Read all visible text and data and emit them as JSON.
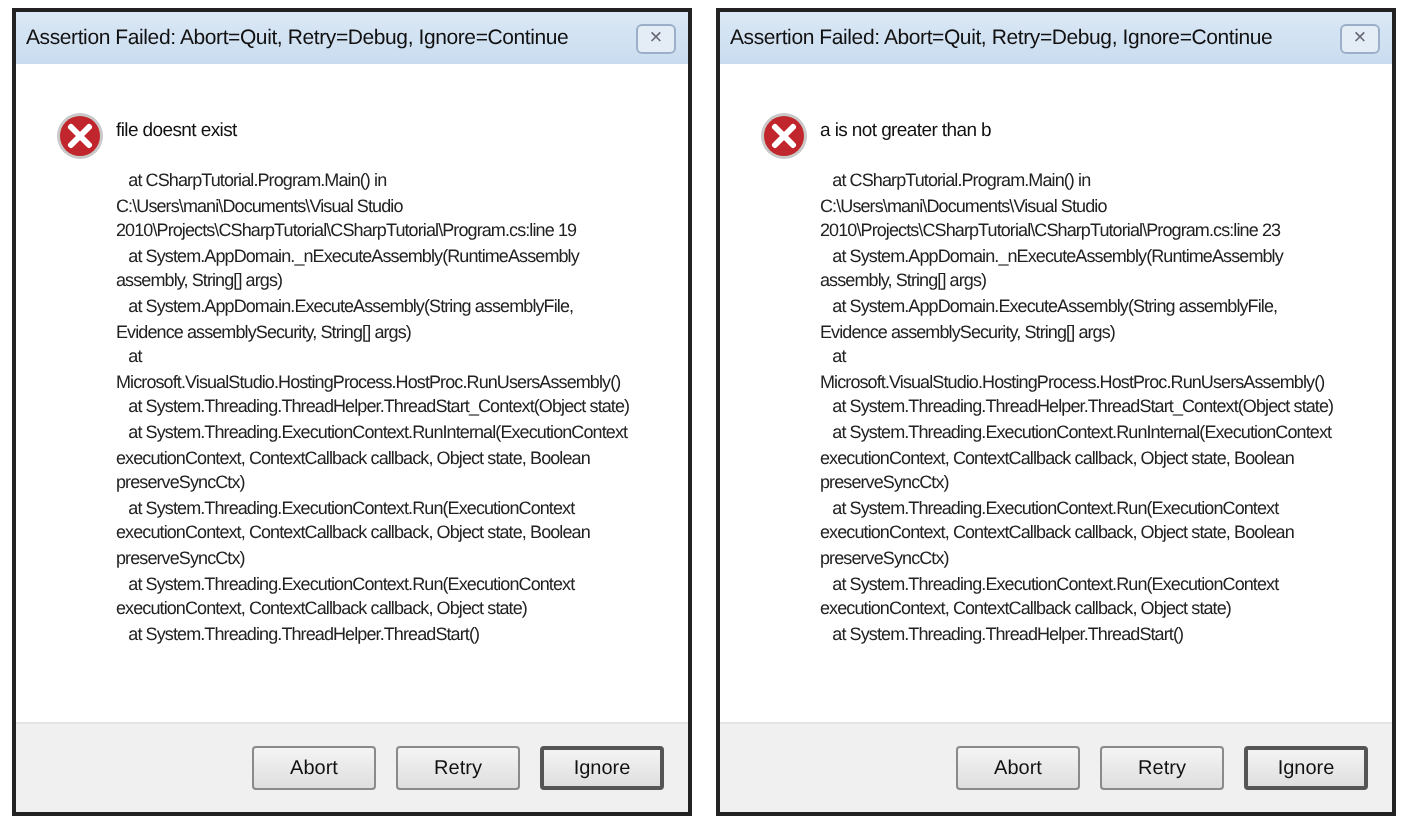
{
  "dialogs": [
    {
      "title": "Assertion Failed: Abort=Quit, Retry=Debug, Ignore=Continue",
      "close": "×",
      "message": "file doesnt exist",
      "stack_lines": [
        "   at CSharpTutorial.Program.Main() in",
        "C:\\Users\\mani\\Documents\\Visual Studio",
        "2010\\Projects\\CSharpTutorial\\CSharpTutorial\\Program.cs:line 19",
        "   at System.AppDomain._nExecuteAssembly(RuntimeAssembly",
        "assembly, String[] args)",
        "   at System.AppDomain.ExecuteAssembly(String assemblyFile,",
        "Evidence assemblySecurity, String[] args)",
        "   at",
        "Microsoft.VisualStudio.HostingProcess.HostProc.RunUsersAssembly()",
        "   at System.Threading.ThreadHelper.ThreadStart_Context(Object state)",
        "   at System.Threading.ExecutionContext.RunInternal(ExecutionContext",
        "executionContext, ContextCallback callback, Object state, Boolean",
        "preserveSyncCtx)",
        "   at System.Threading.ExecutionContext.Run(ExecutionContext",
        "executionContext, ContextCallback callback, Object state, Boolean",
        "preserveSyncCtx)",
        "   at System.Threading.ExecutionContext.Run(ExecutionContext",
        "executionContext, ContextCallback callback, Object state)",
        "   at System.Threading.ThreadHelper.ThreadStart()"
      ],
      "buttons": [
        {
          "label": "Abort",
          "default": false
        },
        {
          "label": "Retry",
          "default": false
        },
        {
          "label": "Ignore",
          "default": true
        }
      ]
    },
    {
      "title": "Assertion Failed: Abort=Quit, Retry=Debug, Ignore=Continue",
      "close": "×",
      "message": "a is not greater than b",
      "stack_lines": [
        "   at CSharpTutorial.Program.Main() in",
        "C:\\Users\\mani\\Documents\\Visual Studio",
        "2010\\Projects\\CSharpTutorial\\CSharpTutorial\\Program.cs:line 23",
        "   at System.AppDomain._nExecuteAssembly(RuntimeAssembly",
        "assembly, String[] args)",
        "   at System.AppDomain.ExecuteAssembly(String assemblyFile,",
        "Evidence assemblySecurity, String[] args)",
        "   at",
        "Microsoft.VisualStudio.HostingProcess.HostProc.RunUsersAssembly()",
        "   at System.Threading.ThreadHelper.ThreadStart_Context(Object state)",
        "   at System.Threading.ExecutionContext.RunInternal(ExecutionContext",
        "executionContext, ContextCallback callback, Object state, Boolean",
        "preserveSyncCtx)",
        "   at System.Threading.ExecutionContext.Run(ExecutionContext",
        "executionContext, ContextCallback callback, Object state, Boolean",
        "preserveSyncCtx)",
        "   at System.Threading.ExecutionContext.Run(ExecutionContext",
        "executionContext, ContextCallback callback, Object state)",
        "   at System.Threading.ThreadHelper.ThreadStart()"
      ],
      "buttons": [
        {
          "label": "Abort",
          "default": false
        },
        {
          "label": "Retry",
          "default": false
        },
        {
          "label": "Ignore",
          "default": true
        }
      ]
    }
  ]
}
